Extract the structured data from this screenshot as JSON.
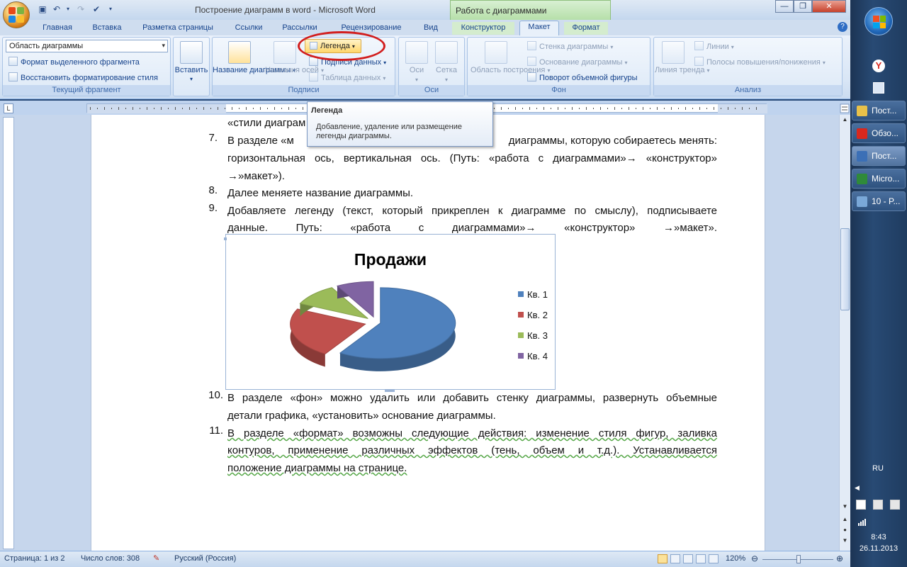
{
  "window": {
    "title": "Построение диаграмм в word - Microsoft Word",
    "context_title": "Работа с диаграммами"
  },
  "tabs": [
    {
      "label": "Главная"
    },
    {
      "label": "Вставка"
    },
    {
      "label": "Разметка страницы"
    },
    {
      "label": "Ссылки"
    },
    {
      "label": "Рассылки"
    },
    {
      "label": "Рецензирование"
    },
    {
      "label": "Вид"
    },
    {
      "label": "Конструктор"
    },
    {
      "label": "Макет"
    },
    {
      "label": "Формат"
    }
  ],
  "ribbon": {
    "current_fragment": {
      "combo_value": "Область диаграммы",
      "format_selection": "Формат выделенного фрагмента",
      "reset_style": "Восстановить форматирование стиля",
      "label": "Текущий фрагмент"
    },
    "insert": {
      "label": "Вставить"
    },
    "labels_group": {
      "chart_title": "Название диаграммы",
      "axis_titles": "Названия осей",
      "legend": "Легенда",
      "data_labels": "Подписи данных",
      "data_table": "Таблица данных",
      "label": "Подписи"
    },
    "axes_group": {
      "axes": "Оси",
      "grid": "Сетка",
      "label": "Оси"
    },
    "background_group": {
      "plot_area": "Область построения",
      "chart_wall": "Стенка диаграммы",
      "chart_floor": "Основание диаграммы",
      "rotation_3d": "Поворот объемной фигуры",
      "label": "Фон"
    },
    "analysis_group": {
      "trendline": "Линия тренда",
      "lines": "Линии",
      "updown_bars": "Полосы повышения/понижения",
      "label": "Анализ"
    }
  },
  "tooltip": {
    "title": "Легенда",
    "body": "Добавление, удаление или размещение легенды диаграммы."
  },
  "document": {
    "fragment_top": "«стили диаграм",
    "item7_num": "7.",
    "item7_line1a": "В разделе «м",
    "item7_line1b": "диаграммы, которую собираетесь менять:",
    "item7_line2": "горизонтальная ось, вертикальная ось. (Путь: «работа с диаграммами»→ «конструктор»",
    "item7_line3": "→»макет»).",
    "item8_num": "8.",
    "item8_line1": "Далее меняете название диаграммы.",
    "item9_num": "9.",
    "item9_line1": "Добавляете легенду (текст, который прикреплен к диаграмме по смыслу),  подписываете",
    "item9_line2": "данные.   Путь:      «работа   с   диаграммами»→   «конструктор»   →»макет».",
    "item10_num": "10.",
    "item10_line1": "В разделе «фон» можно удалить или добавить стенку диаграммы, развернуть объемные",
    "item10_line2": "детали графика, «установить» основание диаграммы.",
    "item11_num": "11.",
    "item11_line1": "В разделе «формат» возможны следующие действия:  изменение стиля фигур, заливка",
    "item11_line2": "контуров,  применение  различных  эффектов  (тень,  объем  и  т.д.).  Устанавливается",
    "item11_line3": "положение диаграммы на странице."
  },
  "chart_data": {
    "type": "pie",
    "title": "Продажи",
    "categories": [
      "Кв. 1",
      "Кв. 2",
      "Кв. 3",
      "Кв. 4"
    ],
    "values": [
      59,
      23,
      10,
      8
    ],
    "colors": [
      "#4f81bd",
      "#c0504d",
      "#9bbb59",
      "#8064a2"
    ],
    "legend_position": "right",
    "three_d": true,
    "exploded": true
  },
  "status": {
    "page": "Страница: 1 из 2",
    "words": "Число слов: 308",
    "language": "Русский (Россия)",
    "zoom": "120%"
  },
  "taskbar": {
    "items": [
      {
        "label": "Пост...",
        "icon": "folder-icon",
        "color": "#e8c14a"
      },
      {
        "label": "Обзо...",
        "icon": "yandex-icon",
        "color": "#d8281e"
      },
      {
        "label": "Пост...",
        "icon": "word-icon",
        "color": "#3b6fb6"
      },
      {
        "label": "Micro...",
        "icon": "excel-icon",
        "color": "#2f8a3a"
      },
      {
        "label": "10 - P...",
        "icon": "paint-icon",
        "color": "#7aa8d8"
      }
    ],
    "lang": "RU",
    "time": "8:43",
    "date": "26.11.2013"
  }
}
